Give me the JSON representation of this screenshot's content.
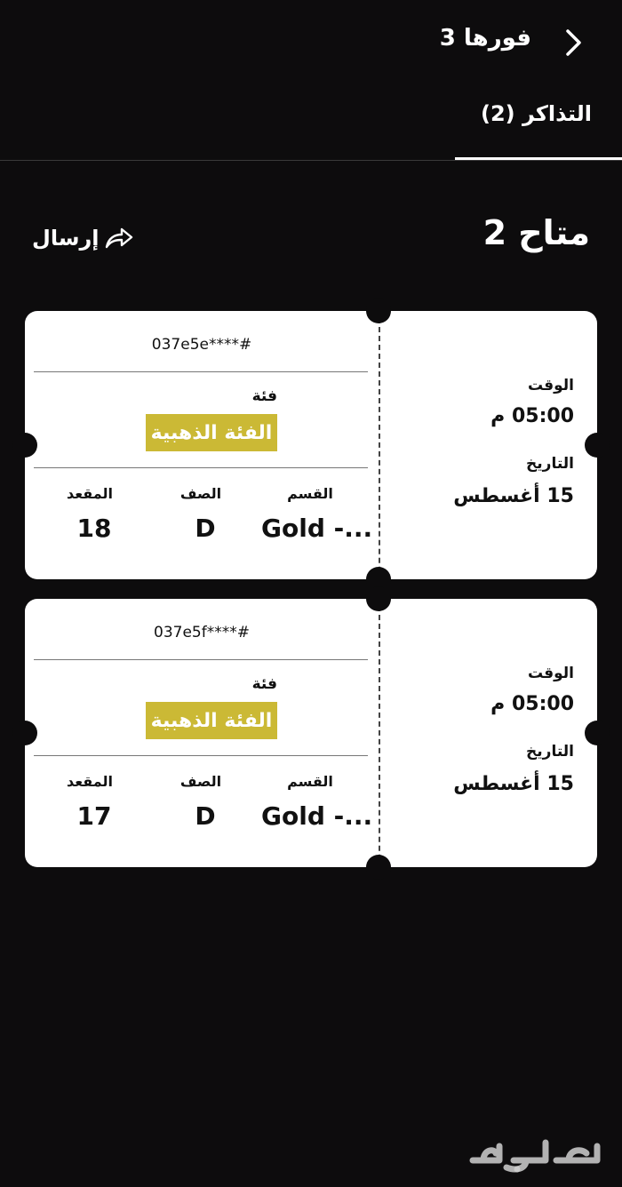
{
  "header": {
    "title": "فورها 3",
    "back_icon": "chevron-right-icon"
  },
  "tabs": [
    {
      "label": "التذاكر (2)",
      "active": true
    }
  ],
  "section": {
    "title": "متاح 2",
    "send_label": "إرسال",
    "send_icon": "share-arrow-icon"
  },
  "tickets": [
    {
      "code": "037e5e****#",
      "category_label": "فئة",
      "category_value": "الفئة الذهبية",
      "seat_label": "المقعد",
      "seat_value": "18",
      "row_label": "الصف",
      "row_value": "D",
      "section_label": "القسم",
      "section_value": "Gold -...",
      "time_label": "الوقت",
      "time_value": "05:00 م",
      "date_label": "التاريخ",
      "date_value": "15 أغسطس"
    },
    {
      "code": "037e5f****#",
      "category_label": "فئة",
      "category_value": "الفئة الذهبية",
      "seat_label": "المقعد",
      "seat_value": "17",
      "row_label": "الصف",
      "row_value": "D",
      "section_label": "القسم",
      "section_value": "Gold -...",
      "time_label": "الوقت",
      "time_value": "05:00 م",
      "date_label": "التاريخ",
      "date_value": "15 أغسطس"
    }
  ],
  "colors": {
    "background": "#0d0c0d",
    "card": "#ffffff",
    "gold_badge": "#cbb935"
  },
  "watermark": {
    "text": "حراج"
  }
}
